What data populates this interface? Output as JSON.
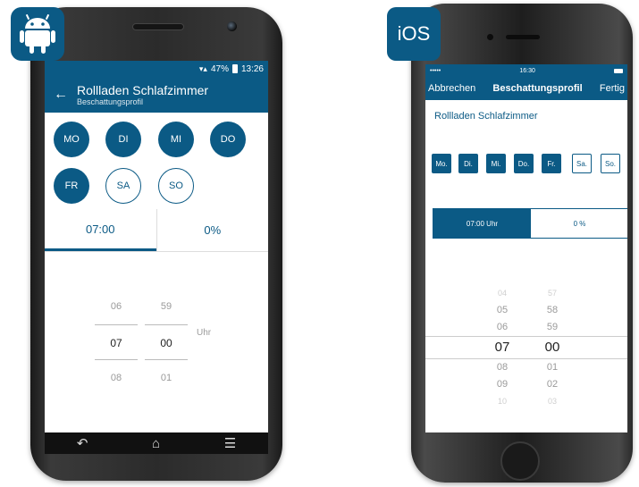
{
  "android": {
    "badge_icon": "android-robot-icon",
    "status": {
      "battery": "47%",
      "time": "13:26"
    },
    "appbar": {
      "title": "Rollladen Schlafzimmer",
      "subtitle": "Beschattungsprofil"
    },
    "days": [
      {
        "label": "MO",
        "active": true
      },
      {
        "label": "DI",
        "active": true
      },
      {
        "label": "MI",
        "active": true
      },
      {
        "label": "DO",
        "active": true
      },
      {
        "label": "FR",
        "active": true
      },
      {
        "label": "SA",
        "active": false
      },
      {
        "label": "SO",
        "active": false
      }
    ],
    "tabs": [
      {
        "label": "07:00",
        "active": true
      },
      {
        "label": "0%",
        "active": false
      }
    ],
    "picker": {
      "hours": [
        "06",
        "07",
        "08"
      ],
      "minutes": [
        "59",
        "00",
        "01"
      ],
      "unit": "Uhr"
    }
  },
  "ios": {
    "badge_label": "iOS",
    "status": {
      "signal": "••••• ",
      "time": "16:30"
    },
    "nav": {
      "left": "Abbrechen",
      "title": "Beschattungsprofil",
      "right": "Fertig"
    },
    "name": "Rollladen Schlafzimmer",
    "days": [
      {
        "label": "Mo.",
        "active": true
      },
      {
        "label": "Di.",
        "active": true
      },
      {
        "label": "Mi.",
        "active": true
      },
      {
        "label": "Do.",
        "active": true
      },
      {
        "label": "Fr.",
        "active": true
      },
      {
        "label": "Sa.",
        "active": false
      },
      {
        "label": "So.",
        "active": false
      }
    ],
    "segments": [
      {
        "label": "07:00 Uhr",
        "active": true
      },
      {
        "label": "0 %",
        "active": false
      }
    ],
    "picker": {
      "hours": [
        "04",
        "05",
        "06",
        "07",
        "08",
        "09",
        "10"
      ],
      "minutes": [
        "57",
        "58",
        "59",
        "00",
        "01",
        "02",
        "03"
      ]
    }
  },
  "colors": {
    "primary": "#0b5a85"
  }
}
